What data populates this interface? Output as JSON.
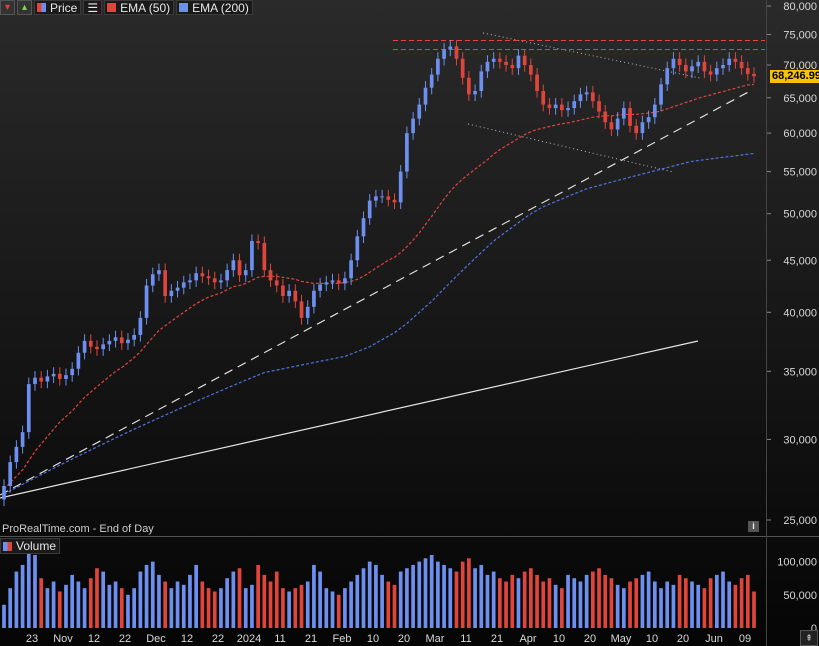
{
  "legend": {
    "price_label": "Price",
    "ema50_label": "EMA (50)",
    "ema200_label": "EMA (200)",
    "volume_label": "Volume"
  },
  "footer": {
    "source": "ProRealTime.com - End of Day"
  },
  "last_price": "68,246.99",
  "colors": {
    "up": "#6d8ff0",
    "down": "#e0453c",
    "ema50": "#e0453c",
    "ema200": "#4d74e0",
    "price_tag": "#f5c400"
  },
  "icons": {
    "info": "i",
    "scroll": "⇞"
  },
  "chart_data": {
    "type": "candlestick",
    "scale": "log",
    "ylim": [
      24000,
      82000
    ],
    "yticks": [
      80000,
      75000,
      70000,
      65000,
      60000,
      55000,
      50000,
      45000,
      40000,
      35000,
      30000,
      25000
    ],
    "ytick_labels": [
      "80,000",
      "75,000",
      "70,000",
      "65,000",
      "60,000",
      "55,000",
      "50,000",
      "45,000",
      "40,000",
      "35,000",
      "30,000",
      "25,000"
    ],
    "xtick_labels": [
      "23",
      "Nov",
      "12",
      "22",
      "Dec",
      "12",
      "22",
      "2024",
      "11",
      "21",
      "Feb",
      "10",
      "20",
      "Mar",
      "11",
      "21",
      "Apr",
      "10",
      "20",
      "May",
      "10",
      "20",
      "Jun",
      "09"
    ],
    "close": [
      27000,
      28500,
      29500,
      30500,
      34000,
      34500,
      34200,
      34600,
      34800,
      34400,
      34700,
      35200,
      36500,
      37500,
      37000,
      36800,
      37200,
      37500,
      37800,
      37300,
      37600,
      38000,
      39500,
      42500,
      43600,
      44000,
      41500,
      42000,
      42300,
      42800,
      43000,
      43700,
      43400,
      43200,
      42800,
      43000,
      44000,
      45000,
      43500,
      44000,
      47000,
      46800,
      44000,
      43000,
      42500,
      41500,
      42000,
      41000,
      39500,
      40500,
      42000,
      42600,
      42800,
      43000,
      42700,
      43200,
      45000,
      47500,
      49500,
      51500,
      52000,
      52000,
      51600,
      51300,
      55000,
      60000,
      62000,
      64000,
      66500,
      68500,
      71000,
      72500,
      73000,
      71000,
      68000,
      65500,
      66000,
      69000,
      70500,
      71000,
      70500,
      70000,
      69500,
      71500,
      70000,
      68500,
      66000,
      64000,
      63500,
      64000,
      63200,
      63500,
      64500,
      65500,
      65800,
      64500,
      63000,
      61500,
      60500,
      62000,
      63500,
      61000,
      60000,
      61500,
      62200,
      64000,
      67000,
      69500,
      71000,
      70000,
      69000,
      69800,
      70500,
      69000,
      68500,
      69500,
      70000,
      71000,
      70500,
      69500,
      68600,
      68246.99
    ],
    "ema50": [
      26800,
      27200,
      27600,
      28000,
      28600,
      29200,
      29700,
      30200,
      30700,
      31200,
      31600,
      32000,
      32500,
      33000,
      33400,
      33800,
      34200,
      34600,
      35000,
      35300,
      35700,
      36100,
      36600,
      37200,
      37800,
      38400,
      38800,
      39200,
      39600,
      40000,
      40400,
      40800,
      41100,
      41400,
      41600,
      41800,
      42100,
      42400,
      42500,
      42700,
      43000,
      43300,
      43400,
      43400,
      43400,
      43300,
      43200,
      43100,
      42900,
      42800,
      42700,
      42700,
      42700,
      42700,
      42700,
      42800,
      42900,
      43100,
      43400,
      43800,
      44200,
      44600,
      45000,
      45300,
      45800,
      46400,
      47100,
      47900,
      48800,
      49700,
      50700,
      51700,
      52600,
      53400,
      54100,
      54700,
      55300,
      55900,
      56500,
      57200,
      57800,
      58300,
      58800,
      59300,
      59800,
      60200,
      60500,
      60700,
      60900,
      61100,
      61300,
      61400,
      61600,
      61800,
      62000,
      62200,
      62300,
      62400,
      62400,
      62500,
      62600,
      62600,
      62600,
      62700,
      62800,
      62900,
      63100,
      63400,
      63700,
      64000,
      64300,
      64600,
      64900,
      65200,
      65400,
      65700,
      65900,
      66200,
      66400,
      66700,
      66900,
      67000
    ],
    "ema200": [
      26500,
      26700,
      26900,
      27100,
      27300,
      27500,
      27700,
      27900,
      28100,
      28300,
      28500,
      28700,
      28900,
      29100,
      29300,
      29500,
      29700,
      29900,
      30100,
      30300,
      30500,
      30700,
      30900,
      31100,
      31300,
      31500,
      31700,
      31900,
      32100,
      32300,
      32500,
      32700,
      32900,
      33100,
      33300,
      33500,
      33700,
      33900,
      34100,
      34300,
      34500,
      34700,
      34900,
      35000,
      35100,
      35200,
      35300,
      35400,
      35500,
      35600,
      35700,
      35800,
      35900,
      36000,
      36100,
      36200,
      36400,
      36600,
      36800,
      37000,
      37300,
      37600,
      37900,
      38200,
      38600,
      39000,
      39500,
      40000,
      40500,
      41000,
      41600,
      42200,
      42800,
      43400,
      44000,
      44600,
      45200,
      45800,
      46400,
      47000,
      47500,
      48000,
      48500,
      49000,
      49500,
      50000,
      50400,
      50800,
      51100,
      51400,
      51700,
      52000,
      52300,
      52600,
      52900,
      53100,
      53300,
      53500,
      53700,
      53900,
      54100,
      54300,
      54500,
      54700,
      54900,
      55100,
      55300,
      55500,
      55700,
      55900,
      56100,
      56300,
      56400,
      56500,
      56600,
      56700,
      56800,
      56900,
      57000,
      57100,
      57200,
      57300
    ],
    "volume": [
      35000,
      60000,
      85000,
      95000,
      120000,
      110000,
      75000,
      60000,
      70000,
      55000,
      65000,
      80000,
      70000,
      60000,
      75000,
      90000,
      85000,
      65000,
      70000,
      60000,
      50000,
      60000,
      85000,
      95000,
      100000,
      80000,
      70000,
      60000,
      70000,
      65000,
      80000,
      95000,
      70000,
      60000,
      55000,
      60000,
      75000,
      85000,
      90000,
      60000,
      65000,
      95000,
      80000,
      70000,
      85000,
      60000,
      55000,
      60000,
      65000,
      70000,
      95000,
      85000,
      60000,
      55000,
      50000,
      60000,
      70000,
      80000,
      90000,
      100000,
      95000,
      80000,
      70000,
      65000,
      85000,
      90000,
      95000,
      100000,
      105000,
      110000,
      100000,
      95000,
      90000,
      85000,
      100000,
      105000,
      90000,
      95000,
      80000,
      85000,
      75000,
      70000,
      80000,
      75000,
      85000,
      90000,
      80000,
      70000,
      75000,
      65000,
      60000,
      80000,
      75000,
      70000,
      80000,
      85000,
      90000,
      80000,
      75000,
      65000,
      60000,
      70000,
      75000,
      80000,
      85000,
      70000,
      60000,
      70000,
      65000,
      80000,
      75000,
      70000,
      65000,
      60000,
      75000,
      80000,
      85000,
      70000,
      65000,
      75000,
      80000,
      55000
    ],
    "vol_ticks": [
      "100,000",
      "50,000",
      "0"
    ],
    "vol_tick_values": [
      100000,
      50000,
      0
    ],
    "trendlines": [
      {
        "kind": "horizontal",
        "price": 74000
      },
      {
        "kind": "horizontal",
        "price": 72500
      }
    ]
  }
}
